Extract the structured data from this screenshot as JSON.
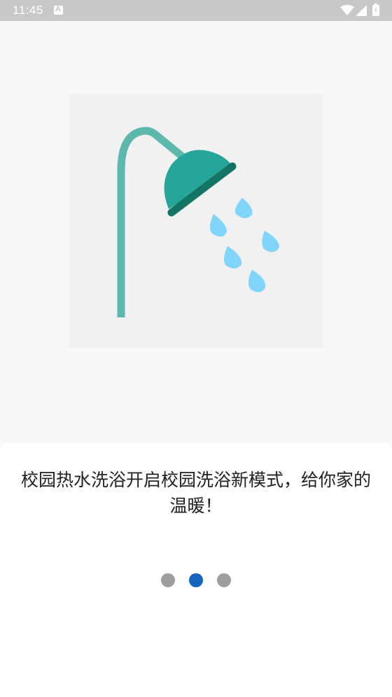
{
  "status_bar": {
    "time": "11:45"
  },
  "onboarding": {
    "slogan": "校园热水洗浴开启校园洗浴新模式，给你家的温暖！",
    "page_count": 3,
    "active_page": 2
  },
  "colors": {
    "pipe": "#5cb8ac",
    "shower_head": "#26a69a",
    "shower_rim": "#137465",
    "water_drop": "#81d4fa",
    "indicator_active": "#1565c0",
    "indicator_inactive": "#9e9e9e"
  }
}
